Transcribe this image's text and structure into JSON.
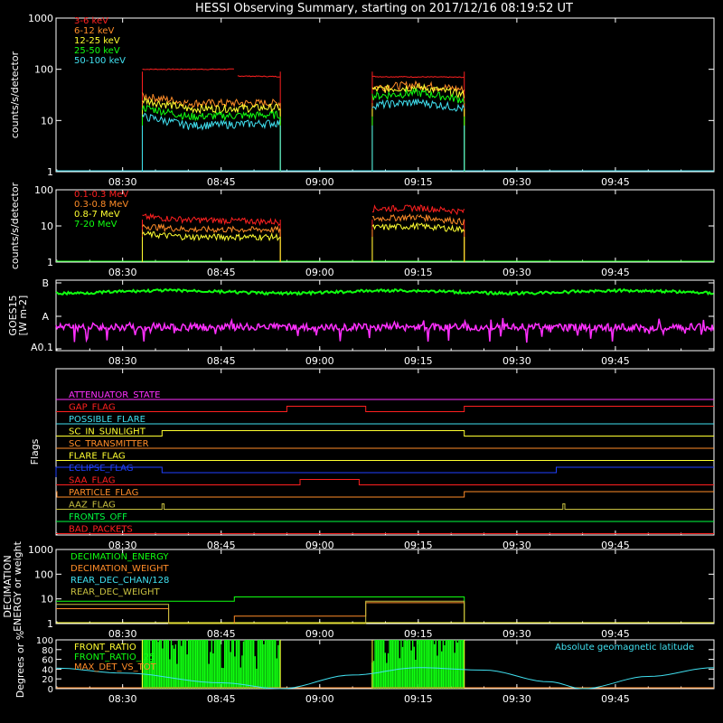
{
  "title": "HESSI Observing Summary, starting on 2017/12/16 08:19:52 UT",
  "time_ticks": [
    "08:30",
    "08:45",
    "09:00",
    "09:15",
    "09:30",
    "09:45"
  ],
  "colors": {
    "red": "#ff2020",
    "orange": "#ff8c28",
    "yellow": "#ffff30",
    "green": "#10ff10",
    "cyan": "#40e0f0",
    "magenta": "#ff30ff",
    "blue": "#2040ff",
    "olive": "#c8c040",
    "green_flag": "#00ff40",
    "gray": "#c0c0c0"
  },
  "chart_data": [
    {
      "id": "counts_low",
      "type": "line",
      "ylabel": "counts/s/detector",
      "yscale": "log",
      "ylim": [
        1,
        1000
      ],
      "yticks": [
        "1",
        "10",
        "100",
        "1000"
      ],
      "x_unit": "UT time",
      "xlim": [
        "08:19:52",
        "10:00:00"
      ],
      "legend": [
        "3-6 keV",
        "6-12 keV",
        "12-25 keV",
        "25-50 keV",
        "50-100 keV"
      ],
      "series": [
        {
          "name": "3-6 keV",
          "values": [
            [
              "08:33",
              100
            ],
            [
              "08:47",
              100
            ],
            [
              "08:47.5",
              75
            ],
            [
              "08:54",
              72
            ],
            [
              "09:08",
              72
            ],
            [
              "09:22",
              70
            ]
          ]
        },
        {
          "name": "6-12 keV",
          "values": [
            [
              "08:33",
              30
            ],
            [
              "08:40",
              22
            ],
            [
              "08:54",
              22
            ],
            [
              "09:08",
              45
            ],
            [
              "09:15",
              50
            ],
            [
              "09:22",
              40
            ]
          ]
        },
        {
          "name": "12-25 keV",
          "values": [
            [
              "08:33",
              25
            ],
            [
              "08:40",
              17
            ],
            [
              "08:54",
              18
            ],
            [
              "09:08",
              40
            ],
            [
              "09:15",
              45
            ],
            [
              "09:22",
              32
            ]
          ]
        },
        {
          "name": "25-50 keV",
          "values": [
            [
              "08:33",
              18
            ],
            [
              "08:40",
              12
            ],
            [
              "08:54",
              13
            ],
            [
              "09:08",
              30
            ],
            [
              "09:15",
              35
            ],
            [
              "09:22",
              25
            ]
          ]
        },
        {
          "name": "50-100 keV",
          "values": [
            [
              "08:33",
              12
            ],
            [
              "08:40",
              8
            ],
            [
              "08:54",
              9
            ],
            [
              "09:08",
              20
            ],
            [
              "09:15",
              23
            ],
            [
              "09:22",
              17
            ]
          ]
        }
      ]
    },
    {
      "id": "counts_high",
      "type": "line",
      "ylabel": "counts/s/detector",
      "yscale": "log",
      "ylim": [
        1,
        100
      ],
      "yticks": [
        "1",
        "10",
        "100"
      ],
      "legend": [
        "0.1-0.3 MeV",
        "0.3-0.8 MeV",
        "0.8-7 MeV",
        "7-20 MeV"
      ],
      "series": [
        {
          "name": "0.1-0.3 MeV",
          "values": [
            [
              "08:33",
              18
            ],
            [
              "08:40",
              15
            ],
            [
              "08:54",
              13
            ],
            [
              "09:08",
              30
            ],
            [
              "09:15",
              32
            ],
            [
              "09:22",
              25
            ]
          ]
        },
        {
          "name": "0.3-0.8 MeV",
          "values": [
            [
              "08:33",
              10
            ],
            [
              "08:40",
              8
            ],
            [
              "08:54",
              8
            ],
            [
              "09:08",
              16
            ],
            [
              "09:15",
              18
            ],
            [
              "09:22",
              13
            ]
          ]
        },
        {
          "name": "0.8-7 MeV",
          "values": [
            [
              "08:33",
              6
            ],
            [
              "08:40",
              5
            ],
            [
              "08:54",
              5
            ],
            [
              "09:08",
              9
            ],
            [
              "09:15",
              10
            ],
            [
              "09:22",
              8
            ]
          ]
        },
        {
          "name": "7-20 MeV",
          "values": [
            [
              "08:19:52",
              1
            ],
            [
              "10:00",
              1
            ]
          ]
        }
      ]
    },
    {
      "id": "goes",
      "type": "line",
      "ylabel": "GOES15",
      "ylabel2": "[W m-2]",
      "yscale": "log",
      "yticks": [
        "B",
        "A",
        "A0.1"
      ],
      "series": [
        {
          "name": "long",
          "values": [
            [
              "08:19:52",
              "B-"
            ],
            [
              "10:00",
              "B-"
            ]
          ]
        },
        {
          "name": "short",
          "values": [
            [
              "08:19:52",
              "A0.3"
            ],
            [
              "10:00",
              "A0.3"
            ]
          ]
        }
      ]
    },
    {
      "id": "flags",
      "type": "line",
      "ylabel": "Flags",
      "flags": [
        {
          "name": "ATTENUATOR_STATE",
          "steps": []
        },
        {
          "name": "GAP_FLAG",
          "steps": [
            [
              "08:55",
              1
            ],
            [
              "09:07",
              0
            ],
            [
              "09:22",
              1
            ]
          ]
        },
        {
          "name": "POSSIBLE_FLARE",
          "steps": []
        },
        {
          "name": "SC_IN_SUNLIGHT",
          "steps": [
            [
              "08:19:52",
              0
            ],
            [
              "08:36",
              1
            ],
            [
              "09:22",
              0
            ]
          ]
        },
        {
          "name": "SC_TRANSMITTER",
          "steps": []
        },
        {
          "name": "FLARE_FLAG",
          "steps": []
        },
        {
          "name": "ECLIPSE_FLAG",
          "steps": [
            [
              "08:19:52",
              1
            ],
            [
              "08:36",
              0
            ],
            [
              "09:36",
              1
            ]
          ]
        },
        {
          "name": "SAA_FLAG",
          "steps": [
            [
              "08:57",
              1
            ],
            [
              "09:06",
              0
            ]
          ]
        },
        {
          "name": "PARTICLE_FLAG",
          "steps": [
            [
              "08:19:52",
              1
            ],
            [
              "08:20",
              0
            ],
            [
              "09:22",
              1
            ]
          ]
        },
        {
          "name": "AAZ_FLAG",
          "steps": [
            [
              "08:36",
              1
            ],
            [
              "08:36.3",
              0
            ],
            [
              "09:37",
              1
            ],
            [
              "09:37.3",
              0
            ]
          ]
        },
        {
          "name": "FRONTS_OFF",
          "steps": []
        },
        {
          "name": "BAD_PACKETS",
          "steps": []
        }
      ]
    },
    {
      "id": "decimation",
      "type": "line",
      "ylabel": "DECIMATION",
      "ylabel2": "ENERGY or weight",
      "yscale": "log",
      "ylim": [
        1,
        1000
      ],
      "yticks": [
        "1",
        "10",
        "100",
        "1000"
      ],
      "legend": [
        "DECIMATION_ENERGY",
        "DECIMATION_WEIGHT",
        "REAR_DEC_CHAN/128",
        "REAR_DEC_WEIGHT"
      ],
      "series": [
        {
          "name": "DECIMATION_ENERGY",
          "values": [
            [
              "08:19:52",
              8
            ],
            [
              "08:47",
              8
            ],
            [
              "08:47",
              12
            ],
            [
              "09:22",
              12
            ]
          ]
        },
        {
          "name": "DECIMATION_WEIGHT",
          "values": [
            [
              "08:19:52",
              4
            ],
            [
              "08:37",
              4
            ],
            [
              "08:37",
              1
            ],
            [
              "08:47",
              1
            ],
            [
              "08:47",
              2
            ],
            [
              "09:07",
              2
            ],
            [
              "09:07",
              7
            ],
            [
              "09:22",
              7
            ]
          ]
        },
        {
          "name": "REAR_DEC_CHAN/128",
          "values": []
        },
        {
          "name": "REAR_DEC_WEIGHT",
          "values": [
            [
              "08:19:52",
              6
            ],
            [
              "08:37",
              6
            ],
            [
              "08:37",
              1
            ],
            [
              "09:07",
              1
            ],
            [
              "09:07",
              8
            ],
            [
              "09:22",
              8
            ]
          ]
        }
      ]
    },
    {
      "id": "ratios",
      "type": "line",
      "ylabel": "Degrees or %",
      "ylim": [
        0,
        100
      ],
      "yticks": [
        "0",
        "20",
        "40",
        "60",
        "80",
        "100"
      ],
      "legend": [
        "FRONT_RATIO",
        "FRONT_RATIO_ 25",
        "MAX_DET_VS_TOT"
      ],
      "annotation": "Absolute geomagnetic latitude",
      "series": [
        {
          "name": "Absolute geomagnetic latitude",
          "values": [
            [
              "08:19:52",
              42
            ],
            [
              "08:30",
              32
            ],
            [
              "08:45",
              12
            ],
            [
              "08:54",
              0
            ],
            [
              "09:05",
              28
            ],
            [
              "09:15",
              43
            ],
            [
              "09:25",
              38
            ],
            [
              "09:35",
              14
            ],
            [
              "09:40",
              0
            ],
            [
              "09:50",
              25
            ],
            [
              "10:00",
              43
            ]
          ]
        },
        {
          "name": "FRONT_RATIO_ 25",
          "values": [
            [
              "08:33",
              100
            ],
            [
              "08:54",
              100
            ],
            [
              "09:08",
              100
            ],
            [
              "09:22",
              100
            ]
          ]
        }
      ]
    }
  ]
}
